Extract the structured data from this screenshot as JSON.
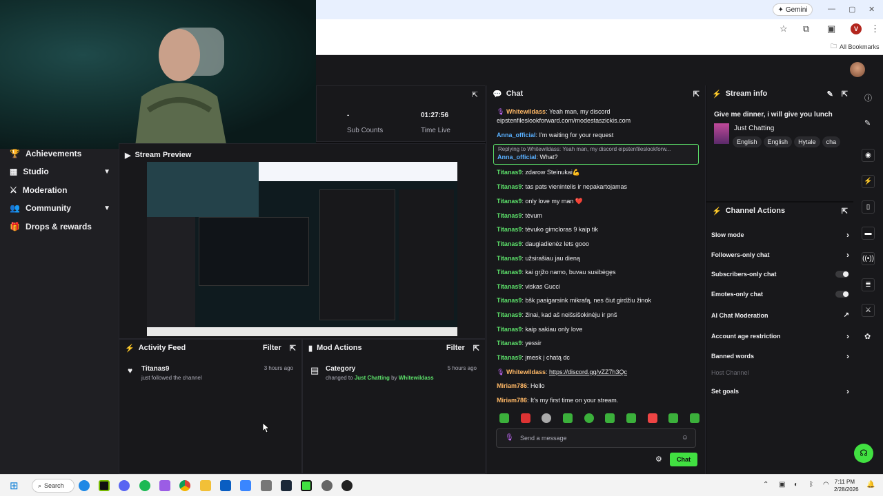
{
  "browser": {
    "gemini_label": "Gemini",
    "bookmarks_label": "All Bookmarks",
    "profile_initial": "V"
  },
  "sidebar": {
    "items": [
      {
        "label": "Achievements",
        "icon": "trophy-icon",
        "chevron": false
      },
      {
        "label": "Studio",
        "icon": "studio-icon",
        "chevron": true
      },
      {
        "label": "Moderation",
        "icon": "sword-icon",
        "chevron": false
      },
      {
        "label": "Community",
        "icon": "community-icon",
        "chevron": true
      },
      {
        "label": "Drops & rewards",
        "icon": "gift-icon",
        "chevron": false
      }
    ]
  },
  "stats": {
    "sub_value": "-",
    "sub_label": "Sub Counts",
    "time_value": "01:27:56",
    "time_label": "Time Live"
  },
  "stream_preview": {
    "title": "Stream Preview"
  },
  "activity_feed": {
    "title": "Activity Feed",
    "filter": "Filter",
    "item_user": "Titanas9",
    "item_text": "just followed the channel",
    "item_time": "3 hours ago"
  },
  "mod_actions": {
    "title": "Mod Actions",
    "filter": "Filter",
    "item_title": "Category",
    "item_prefix": "changed to",
    "item_category": "Just Chatting",
    "item_by": "by",
    "item_user": "Whitewildass",
    "item_time": "5 hours ago"
  },
  "chat": {
    "title": "Chat",
    "reply_label": "Replying to Whitewildass: Yeah man, my discord eipstenfileslookforw...",
    "messages": [
      {
        "user": "Whitewildass",
        "text": "Yeah man, my discord eipstenfileslookforward.com/modestaszickis.com"
      },
      {
        "user": "Anna_official",
        "text": "I'm waiting for your request"
      },
      {
        "user": "Anna_official",
        "text": "What?"
      },
      {
        "user": "Titanas9",
        "text": "zdarow Steinukai💪"
      },
      {
        "user": "Titanas9",
        "text": "tas pats vienintelis ir nepakartojamas"
      },
      {
        "user": "Titanas9",
        "text": "only love my man ❤️"
      },
      {
        "user": "Titanas9",
        "text": "tėvum"
      },
      {
        "user": "Titanas9",
        "text": "tėvuko gimcloras 9 kaip tik"
      },
      {
        "user": "Titanas9",
        "text": "daugiadienėz lets gooo"
      },
      {
        "user": "Titanas9",
        "text": "užsirašiau jau dieną"
      },
      {
        "user": "Titanas9",
        "text": "kai grįžo namo, buvau susibėgęs"
      },
      {
        "user": "Titanas9",
        "text": "viskas Gucci"
      },
      {
        "user": "Titanas9",
        "text": "bšk pasigarsink mikrafą, nes čiut girdžiu žinok"
      },
      {
        "user": "Titanas9",
        "text": "žinai, kad aš neišsišokinėju ir pnš"
      },
      {
        "user": "Titanas9",
        "text": "kaip sakiau only love"
      },
      {
        "user": "Titanas9",
        "text": "yessir"
      },
      {
        "user": "Titanas9",
        "text": "įmesk į chatą dc"
      },
      {
        "user": "Whitewildass",
        "text": "https://discord.gg/vZZ7h3Qc"
      },
      {
        "user": "Miriam786",
        "text": "Hello"
      },
      {
        "user": "Miriam786",
        "text": "It's my first time on your stream."
      }
    ],
    "input_placeholder": "Send a message",
    "send_label": "Chat"
  },
  "stream_info": {
    "title": "Stream info",
    "stream_title": "Give me dinner, i will give you lunch",
    "category": "Just Chatting",
    "tags": [
      "English",
      "English",
      "Hytale",
      "cha"
    ]
  },
  "channel_actions": {
    "title": "Channel Actions",
    "items": [
      {
        "label": "Slow mode",
        "control": "arrow"
      },
      {
        "label": "Followers-only chat",
        "control": "arrow"
      },
      {
        "label": "Subscribers-only chat",
        "control": "toggle"
      },
      {
        "label": "Emotes-only chat",
        "control": "toggle"
      },
      {
        "label": "AI Chat Moderation",
        "control": "external"
      },
      {
        "label": "Account age restriction",
        "control": "arrow"
      },
      {
        "label": "Banned words",
        "control": "arrow"
      },
      {
        "label": "Host Channel",
        "control": "none"
      },
      {
        "label": "Set goals",
        "control": "arrow"
      }
    ]
  },
  "taskbar": {
    "search_label": "Search",
    "time": "7:11 PM",
    "date": "2/28/2026"
  },
  "colors": {
    "accent": "#41e041",
    "bg": "#0e0e10",
    "panel": "#18181b"
  }
}
